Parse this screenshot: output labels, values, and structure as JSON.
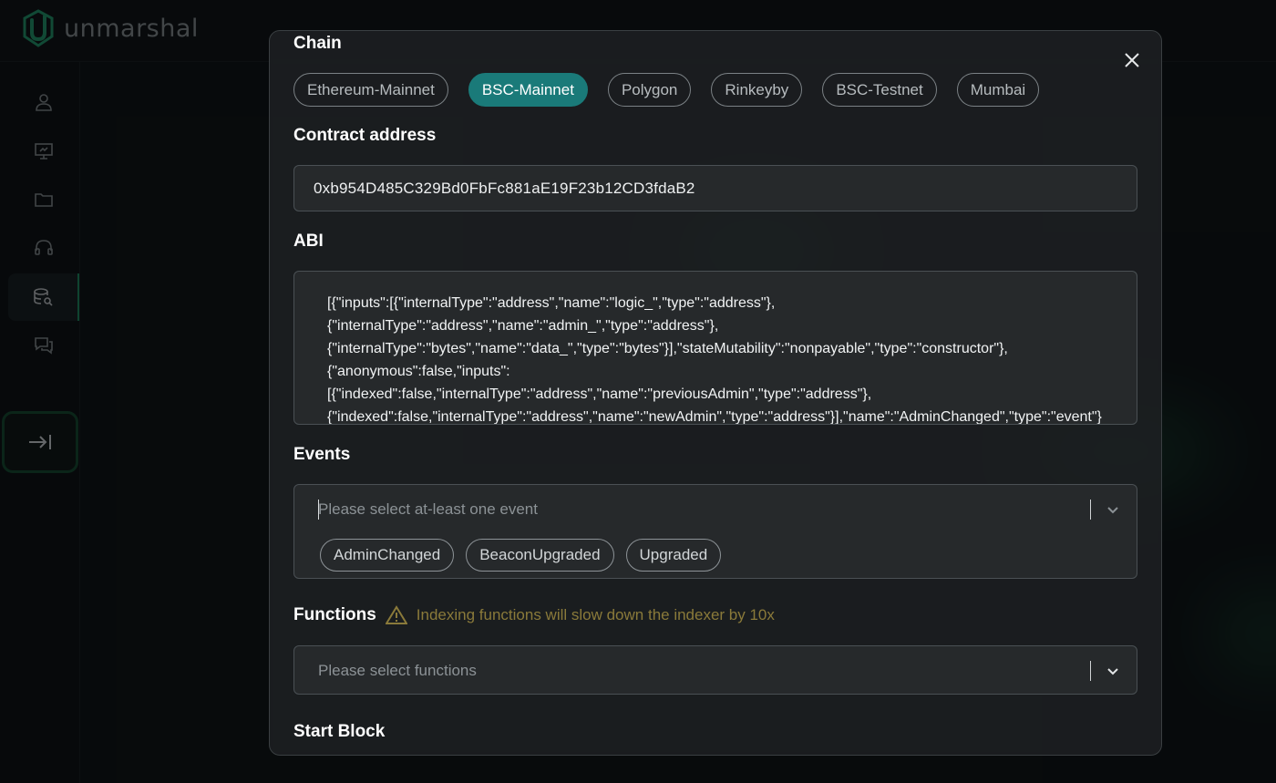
{
  "brand": {
    "name": "unmarshal"
  },
  "sidebar": {
    "items": [
      {
        "icon": "user-icon"
      },
      {
        "icon": "presentation-icon"
      },
      {
        "icon": "folder-icon"
      },
      {
        "icon": "headset-icon"
      },
      {
        "icon": "database-search-icon",
        "active": true
      },
      {
        "icon": "chat-icon"
      }
    ],
    "collapse_icon": "collapse-arrow-icon"
  },
  "modal": {
    "chain": {
      "label": "Chain",
      "options": [
        "Ethereum-Mainnet",
        "BSC-Mainnet",
        "Polygon",
        "Rinkeyby",
        "BSC-Testnet",
        "Mumbai"
      ],
      "selected": "BSC-Mainnet"
    },
    "contract": {
      "label": "Contract address",
      "value": "0xb954D485C329Bd0FbFc881aE19F23b12CD3fdaB2"
    },
    "abi": {
      "label": "ABI",
      "value": "[{\"inputs\":[{\"internalType\":\"address\",\"name\":\"logic_\",\"type\":\"address\"},\n{\"internalType\":\"address\",\"name\":\"admin_\",\"type\":\"address\"},\n{\"internalType\":\"bytes\",\"name\":\"data_\",\"type\":\"bytes\"}],\"stateMutability\":\"nonpayable\",\"type\":\"constructor\"},\n{\"anonymous\":false,\"inputs\":\n[{\"indexed\":false,\"internalType\":\"address\",\"name\":\"previousAdmin\",\"type\":\"address\"},\n{\"indexed\":false,\"internalType\":\"address\",\"name\":\"newAdmin\",\"type\":\"address\"}],\"name\":\"AdminChanged\",\"type\":\"event\"}"
    },
    "events": {
      "label": "Events",
      "placeholder": "Please select at-least one event",
      "options": [
        "AdminChanged",
        "BeaconUpgraded",
        "Upgraded"
      ]
    },
    "functions": {
      "label": "Functions",
      "warning": "Indexing functions will slow down the indexer by 10x",
      "placeholder": "Please select functions"
    },
    "start_block": {
      "label": "Start Block"
    }
  },
  "colors": {
    "accent": "#1a7a79",
    "warning": "#8a7a3a",
    "sidebar_active": "#1b8f5f"
  }
}
